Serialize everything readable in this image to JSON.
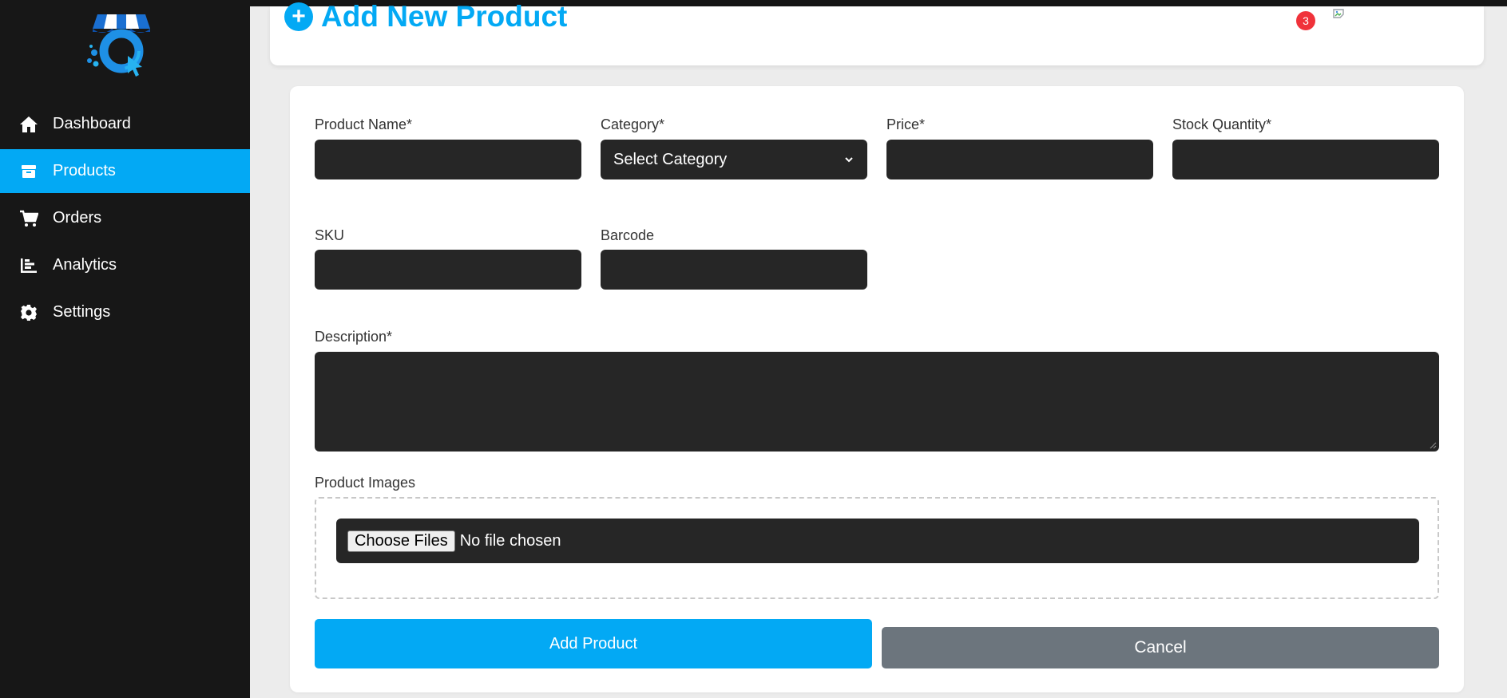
{
  "header": {
    "title": "Add New Product",
    "notification_count": "3"
  },
  "sidebar": {
    "items": [
      {
        "label": "Dashboard",
        "icon": "home-icon",
        "active": false
      },
      {
        "label": "Products",
        "icon": "box-icon",
        "active": true
      },
      {
        "label": "Orders",
        "icon": "cart-icon",
        "active": false
      },
      {
        "label": "Analytics",
        "icon": "chart-icon",
        "active": false
      },
      {
        "label": "Settings",
        "icon": "gear-icon",
        "active": false
      }
    ]
  },
  "form": {
    "product_name_label": "Product Name*",
    "product_name_value": "",
    "category_label": "Category*",
    "category_selected": "Select Category",
    "price_label": "Price*",
    "price_value": "",
    "stock_label": "Stock Quantity*",
    "stock_value": "",
    "sku_label": "SKU",
    "sku_value": "",
    "barcode_label": "Barcode",
    "barcode_value": "",
    "description_label": "Description*",
    "description_value": "",
    "images_label": "Product Images",
    "choose_files_label": "Choose Files",
    "file_status": "No file chosen",
    "submit_label": "Add Product",
    "cancel_label": "Cancel"
  },
  "colors": {
    "accent": "#03a9f4",
    "sidebar_bg": "#171717",
    "input_bg": "#262626",
    "cancel_bg": "#6c757d",
    "badge": "#f0323a"
  }
}
